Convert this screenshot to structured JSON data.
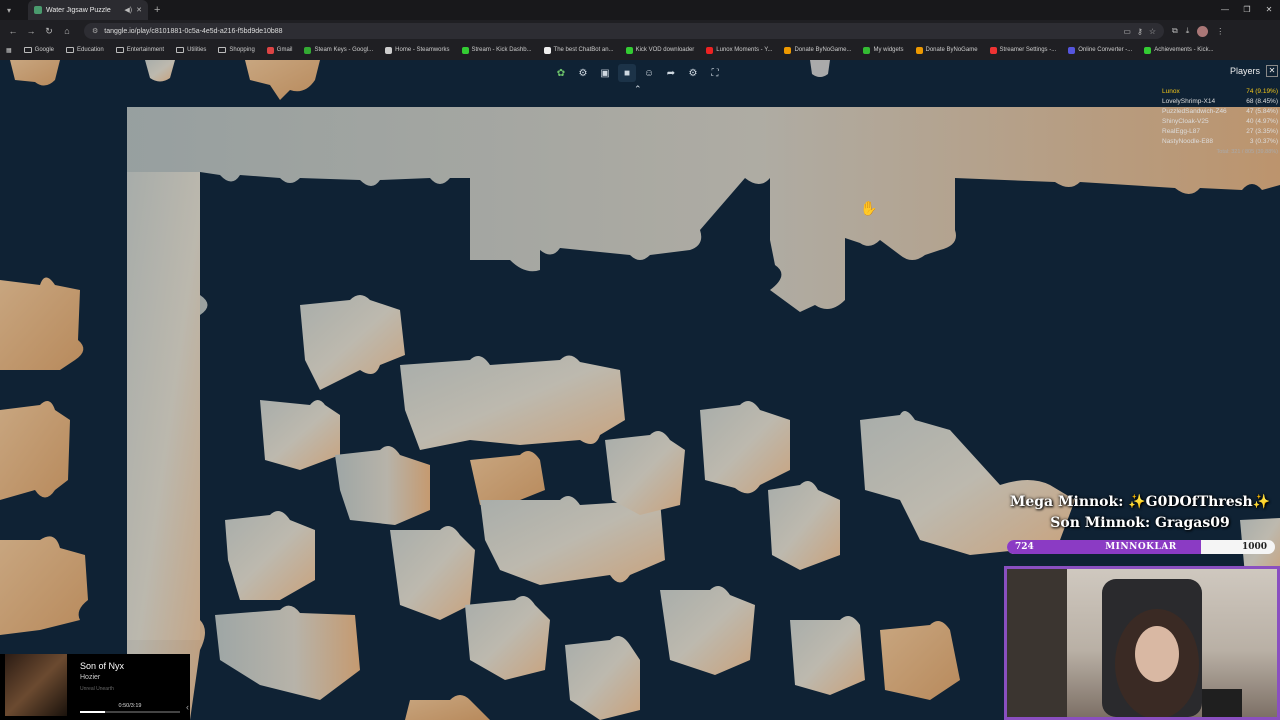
{
  "browser": {
    "tab_title": "Water Jigsaw Puzzle",
    "url": "tanggle.io/play/c8101881-0c5a-4e5d-a216-f5bd9de10b88",
    "bookmarks": [
      "Google",
      "Education",
      "Entertainment",
      "Utilities",
      "Shopping",
      "Gmail",
      "Steam Keys - Googl...",
      "Home - Steamworks",
      "Stream - Kick Dashb...",
      "The best ChatBot an...",
      "Kick VOD downloader",
      "Lunox Moments - Y...",
      "Donate ByNoGame...",
      "My widgets",
      "Donate ByNoGame",
      "Streamer Settings -...",
      "Online Converter -...",
      "Achievements - Kick..."
    ]
  },
  "toolbar": {
    "icons": [
      "puzzle-logo-icon",
      "pieces-icon",
      "image-icon",
      "background-icon",
      "players-icon",
      "share-icon",
      "settings-icon",
      "fullscreen-icon"
    ]
  },
  "players_panel": {
    "title": "Players",
    "players": [
      {
        "name": "Lunox",
        "score": "74 (9.19%)"
      },
      {
        "name": "LovelyShrimp-X14",
        "score": "68 (8.45%)"
      },
      {
        "name": "PuzzledSandwich-Z46",
        "score": "47 (5.84%)"
      },
      {
        "name": "ShinyCloak-V25",
        "score": "40 (4.97%)"
      },
      {
        "name": "RealEgg-L87",
        "score": "27 (3.35%)"
      },
      {
        "name": "NastyNoodle-E88",
        "score": "3 (0.37%)"
      }
    ],
    "total": "Total: 321 / 805 (39.88%)"
  },
  "overlay": {
    "mega_minnok": "Mega Minnok: ✨G0DOfThresh✨",
    "son_minnok": "Son Minnok: Gragas09",
    "bar_current": "724",
    "bar_label": "MINNOKLAR",
    "bar_max": "1000",
    "bar_progress": 0.724
  },
  "music": {
    "song": "Son of Nyx",
    "artist": "Hozier",
    "album": "Unreal Unearth",
    "time": "0:50/3:19",
    "progress": 0.25
  },
  "colors": {
    "board_bg": "#0f2234",
    "accent_purple": "#8b3bc4",
    "player_highlight": "#f0c419"
  }
}
